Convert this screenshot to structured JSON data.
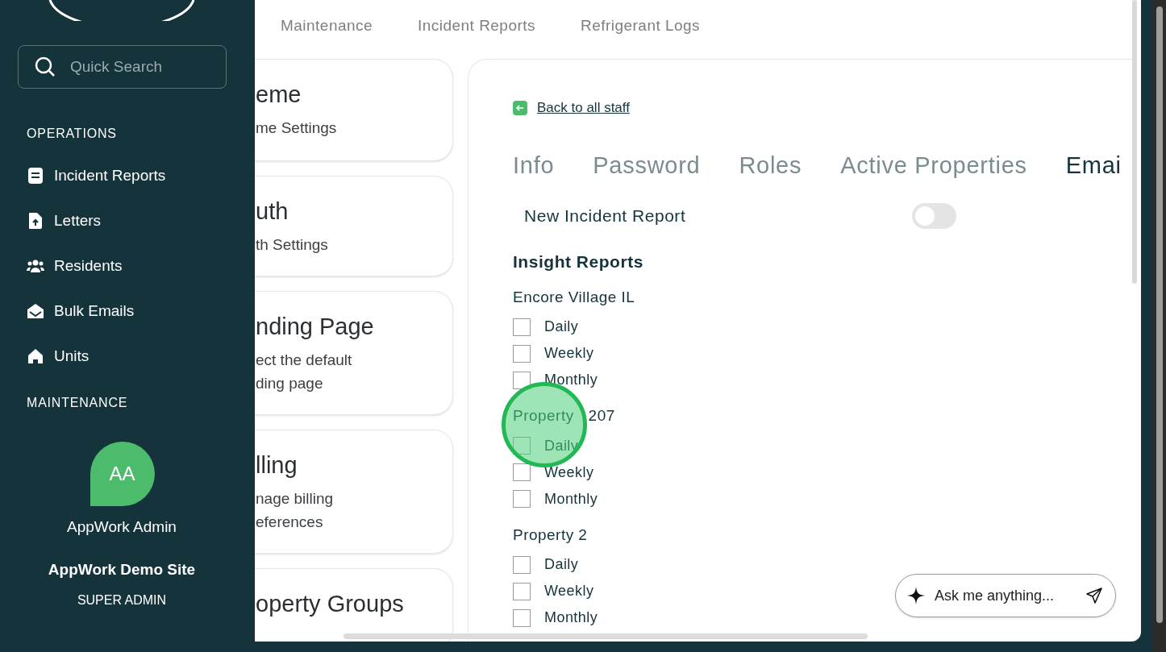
{
  "sidebar": {
    "search": {
      "placeholder": "Quick Search"
    },
    "sections": [
      {
        "title": "OPERATIONS",
        "items": [
          {
            "label": "Incident Reports"
          },
          {
            "label": "Letters"
          },
          {
            "label": "Residents"
          },
          {
            "label": "Bulk Emails"
          },
          {
            "label": "Units"
          }
        ]
      },
      {
        "title": "MAINTENANCE"
      }
    ],
    "user": {
      "initials": "AA",
      "name": "AppWork Admin",
      "site": "AppWork Demo Site",
      "role": "SUPER ADMIN"
    }
  },
  "top_tabs": [
    "Maintenance",
    "Incident Reports",
    "Refrigerant Logs"
  ],
  "settings_cards": [
    {
      "title": "eme",
      "lines": [
        "me Settings"
      ]
    },
    {
      "title": "uth",
      "lines": [
        "th Settings"
      ]
    },
    {
      "title": "nding Page",
      "lines": [
        "ect the default",
        "ding page"
      ]
    },
    {
      "title": "lling",
      "lines": [
        "nage billing",
        "eferences"
      ]
    },
    {
      "title": "operty Groups"
    }
  ],
  "back_link": "Back to all staff",
  "tabs": [
    {
      "label": "Info",
      "selected": false
    },
    {
      "label": "Password",
      "selected": false
    },
    {
      "label": "Roles",
      "selected": false
    },
    {
      "label": "Active Properties",
      "selected": false
    },
    {
      "label": "Emai",
      "selected": true
    }
  ],
  "toggle": {
    "label": "New Incident Report",
    "on": false
  },
  "insight_reports": {
    "title": "Insight Reports",
    "properties": [
      {
        "name": "Encore Village IL",
        "options": [
          {
            "label": "Daily",
            "checked": false
          },
          {
            "label": "Weekly",
            "checked": false
          },
          {
            "label": "Monthly",
            "checked": false
          }
        ]
      },
      {
        "name_parts": [
          "Property",
          "207"
        ],
        "options": [
          {
            "label": "Daily",
            "checked": false
          },
          {
            "label": "Weekly",
            "checked": false
          },
          {
            "label": "Monthly",
            "checked": false
          }
        ]
      },
      {
        "name": "Property 2",
        "options": [
          {
            "label": "Daily",
            "checked": false
          },
          {
            "label": "Weekly",
            "checked": false
          },
          {
            "label": "Monthly",
            "checked": false
          }
        ]
      }
    ]
  },
  "chat": {
    "placeholder": "Ask me anything..."
  }
}
